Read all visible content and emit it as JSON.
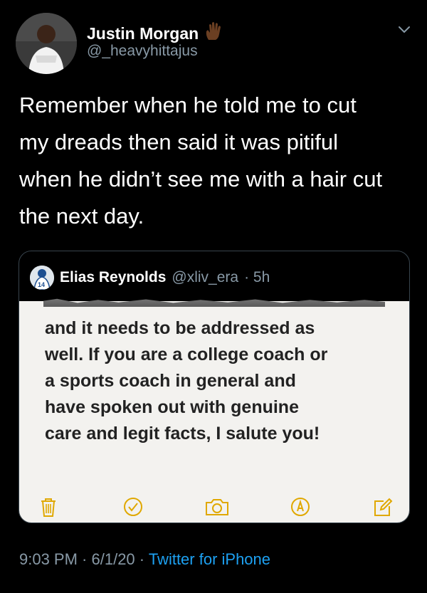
{
  "author": {
    "name": "Justin Morgan",
    "emoji": "✋🏿",
    "handle": "@_heavyhittajus"
  },
  "tweet": {
    "lines": [
      "Remember when he told me to cut",
      "my dreads then said it was pitiful",
      "when he didn’t see me with a hair cut",
      "the next day."
    ]
  },
  "quote": {
    "name": "Elias Reynolds",
    "handle": "@xliv_era",
    "time": "· 5h",
    "note_lines": [
      "and it needs to be addressed as",
      "well. If you are a college coach or",
      "a sports coach in general and",
      "have spoken out with genuine",
      "care and legit facts, I salute you!"
    ],
    "toolbar_icons": [
      "trash-icon",
      "checkmark-circle-icon",
      "camera-icon",
      "pen-circle-icon",
      "compose-icon"
    ]
  },
  "meta": {
    "time": "9:03 PM",
    "separator1": " · ",
    "date": "6/1/20",
    "separator2": " · ",
    "source": "Twitter for iPhone"
  },
  "colors": {
    "background": "#000000",
    "secondary_text": "#8899a6",
    "link": "#1da1f2",
    "notes_accent": "#e0a800"
  }
}
